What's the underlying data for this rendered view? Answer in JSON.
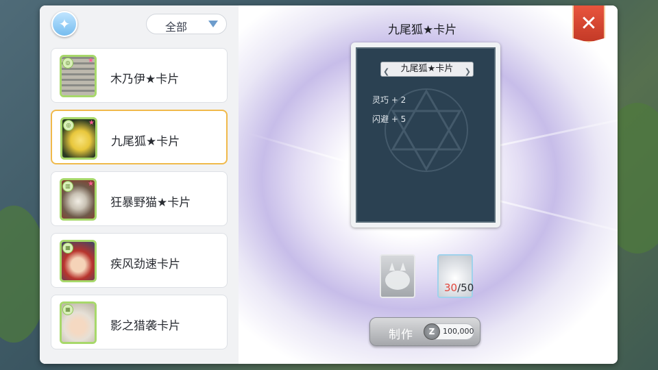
{
  "window": {
    "title": "九尾狐★卡片"
  },
  "filter": {
    "selected": "全部"
  },
  "cards": [
    {
      "name": "木乃伊★卡片",
      "portrait_color": "#8a8b86"
    },
    {
      "name": "九尾狐★卡片",
      "portrait_color": "#e8c73c",
      "selected": true
    },
    {
      "name": "狂暴野猫★卡片",
      "portrait_color": "#6f5a4a"
    },
    {
      "name": "疾风劲速卡片",
      "portrait_color": "#b8352e"
    },
    {
      "name": "影之猎袭卡片",
      "portrait_color": "#e6e0d6"
    }
  ],
  "detail": {
    "card_title": "九尾狐★卡片",
    "stats": [
      "灵巧 + 2",
      "闪避 + 5"
    ]
  },
  "materials": {
    "beast_icon": "wolf-icon",
    "orb_have": "30",
    "orb_sep": "/",
    "orb_need": "50"
  },
  "craft": {
    "label": "制作",
    "cost": "100,000",
    "coin_symbol": "Z"
  },
  "colors": {
    "accent_selected": "#f0b94a",
    "close_red": "#d8462f",
    "count_red": "#e2453a"
  }
}
